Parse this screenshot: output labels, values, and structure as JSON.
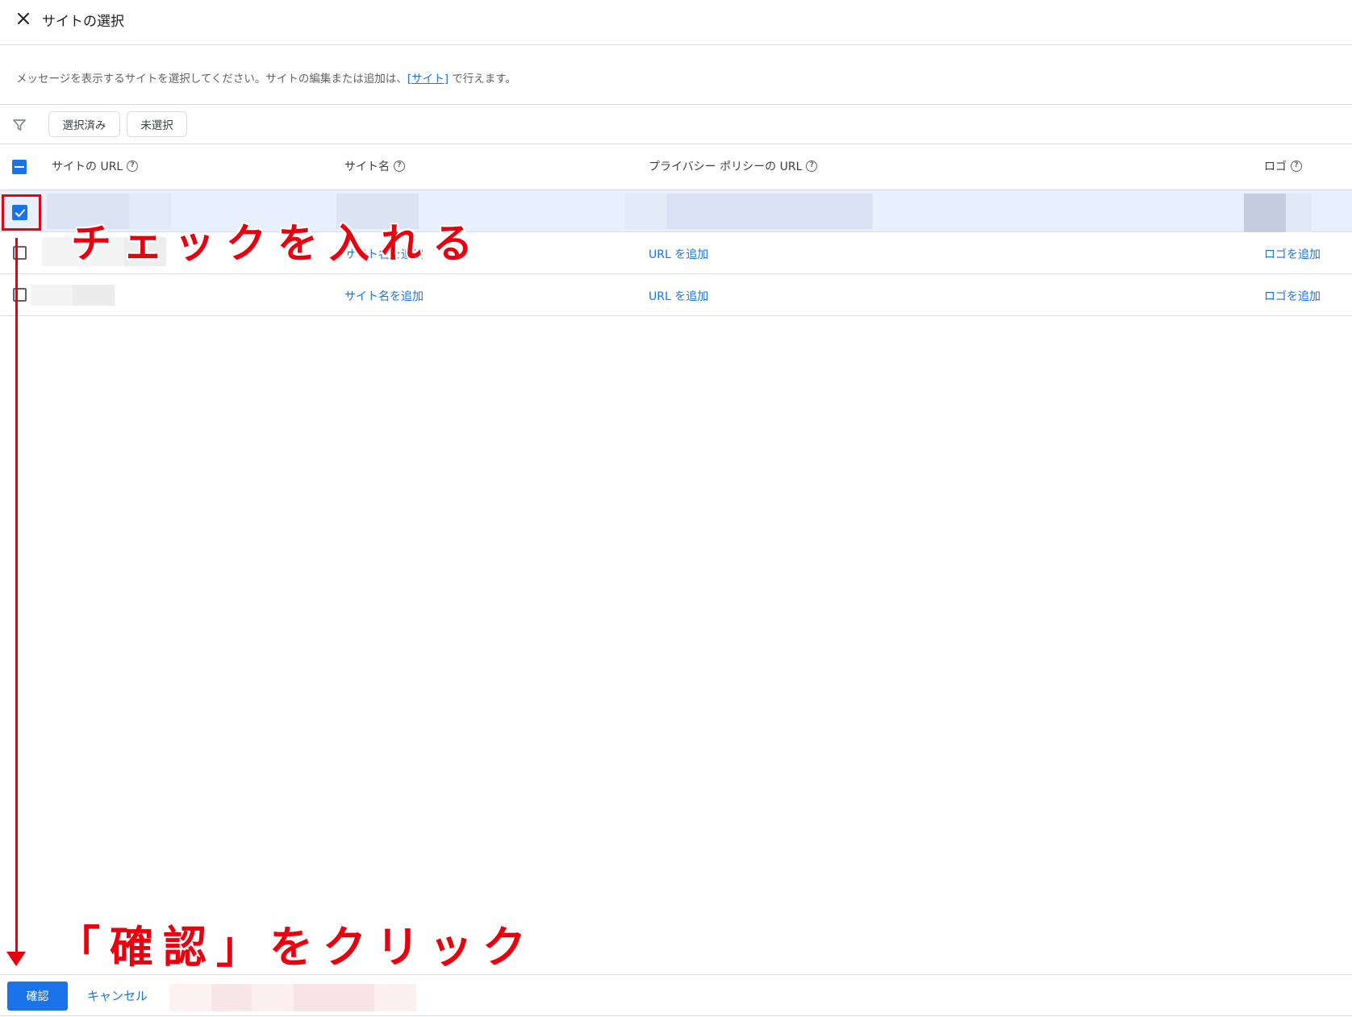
{
  "header": {
    "title": "サイトの選択",
    "close_icon": "close-icon"
  },
  "description": {
    "before": "メッセージを表示するサイトを選択してください。サイトの編集または追加は、",
    "link": "[サイト]",
    "after": " で行えます。"
  },
  "filter": {
    "icon": "filter-icon",
    "chips": {
      "selected": "選択済み",
      "unselected": "未選択"
    }
  },
  "table": {
    "columns": {
      "url": "サイトの URL",
      "name": "サイト名",
      "privacy": "プライバシー ポリシーの URL",
      "logo": "ロゴ"
    },
    "header_checkbox_state": "indeterminate",
    "rows": [
      {
        "checked": true,
        "name_link": "",
        "privacy_link": "",
        "logo_link": ""
      },
      {
        "checked": false,
        "name_link": "サイト名を追加",
        "privacy_link": "URL を追加",
        "logo_link": "ロゴを追加"
      },
      {
        "checked": false,
        "name_link": "サイト名を追加",
        "privacy_link": "URL を追加",
        "logo_link": "ロゴを追加"
      }
    ]
  },
  "annotations": {
    "check": "チェックを入れる",
    "confirm": "「確認」をクリック",
    "color": "#e8000e"
  },
  "footer": {
    "confirm": "確認",
    "cancel": "キャンセル"
  },
  "colors": {
    "accent": "#1a73e8",
    "row_selected": "#e8f0fe",
    "divider": "#dadce0"
  }
}
